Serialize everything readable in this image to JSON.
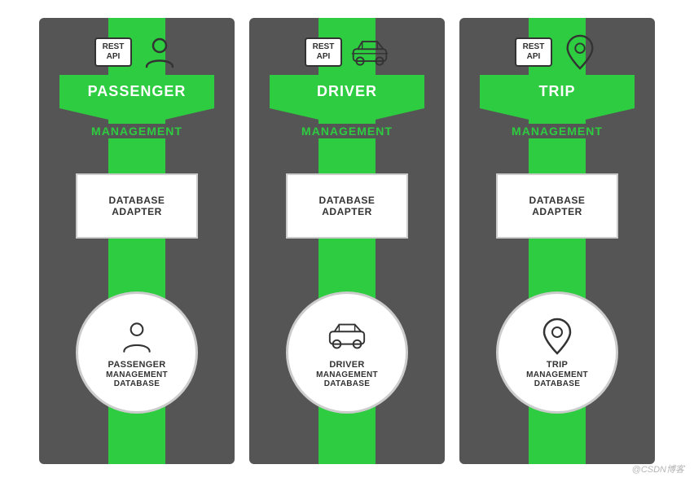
{
  "columns": [
    {
      "id": "passenger",
      "rest_api": "REST\nAPI",
      "main_title": "PASSENGER",
      "sub_title": "MANAGEMENT",
      "db_adapter_line1": "DATABASE",
      "db_adapter_line2": "ADAPTER",
      "bottom_line1": "PASSENGER",
      "bottom_line2": "MANAGEMENT",
      "bottom_line3": "DATABASE",
      "icon_type": "person",
      "bottom_icon_type": "person"
    },
    {
      "id": "driver",
      "rest_api": "REST\nAPI",
      "main_title": "DRIVER",
      "sub_title": "MANAGEMENT",
      "db_adapter_line1": "DATABASE",
      "db_adapter_line2": "ADAPTER",
      "bottom_line1": "DRIVER",
      "bottom_line2": "MANAGEMENT",
      "bottom_line3": "DATABASE",
      "icon_type": "car",
      "bottom_icon_type": "car"
    },
    {
      "id": "trip",
      "rest_api": "REST\nAPI",
      "main_title": "TRIP",
      "sub_title": "MANAGEMENT",
      "db_adapter_line1": "DATABASE",
      "db_adapter_line2": "ADAPTER",
      "bottom_line1": "TRIP",
      "bottom_line2": "MANAGEMENT",
      "bottom_line3": "DATABASE",
      "icon_type": "pin",
      "bottom_icon_type": "pin"
    }
  ],
  "watermark": "@CSDN博客"
}
